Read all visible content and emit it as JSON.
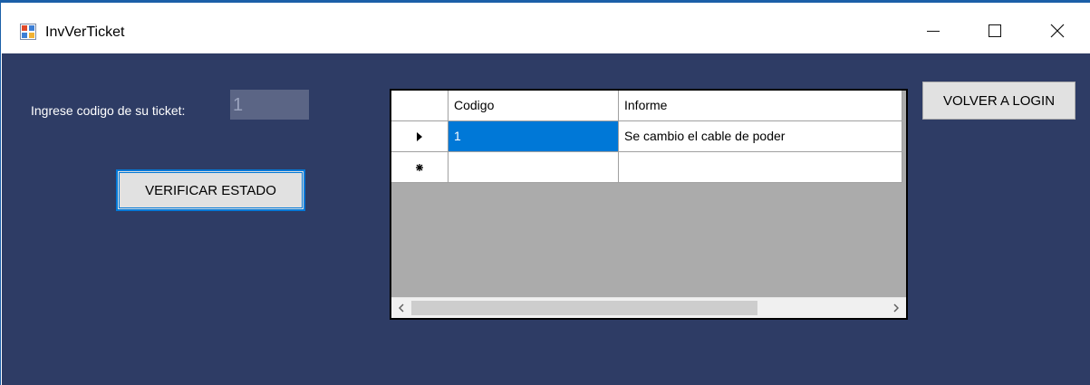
{
  "window": {
    "title": "InvVerTicket",
    "icon": "winforms-app-icon",
    "controls": {
      "minimize": "minimize-icon",
      "maximize": "maximize-icon",
      "close": "close-icon"
    }
  },
  "form": {
    "ticket_label": "Ingrese codigo de su ticket:",
    "ticket_value": "1",
    "verify_button": "VERIFICAR ESTADO",
    "back_button": "VOLVER A LOGIN"
  },
  "grid": {
    "columns": [
      "Codigo",
      "Informe"
    ],
    "rows": [
      {
        "indicator": "current-row-arrow-icon",
        "codigo": "1",
        "informe": "Se cambio el cable de poder",
        "selected_cell": "codigo"
      },
      {
        "indicator": "new-row-asterisk-icon",
        "codigo": "",
        "informe": ""
      }
    ],
    "scrollbar": {
      "left": "scroll-left-icon",
      "right": "scroll-right-icon"
    }
  },
  "colors": {
    "client_background": "#2e3c65",
    "input_background": "#5b6585",
    "selection": "#0078d7",
    "grid_background": "#ababab"
  }
}
